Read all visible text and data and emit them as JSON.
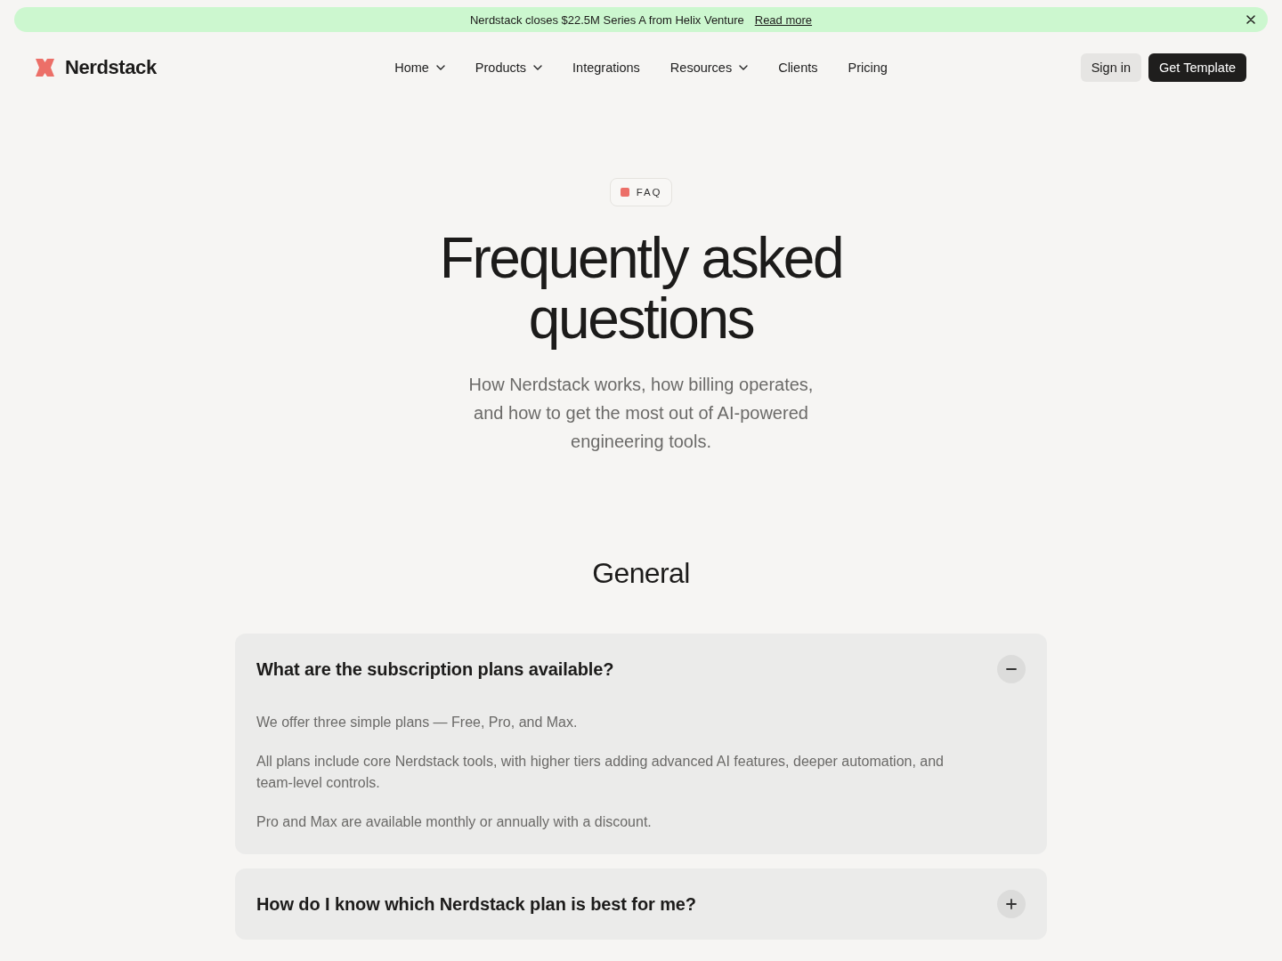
{
  "announcement": {
    "text": "Nerdstack closes $22.5M Series A from Helix Venture",
    "link": "Read more"
  },
  "nav": {
    "brand": "Nerdstack",
    "links": [
      {
        "label": "Home",
        "dropdown": true
      },
      {
        "label": "Products",
        "dropdown": true
      },
      {
        "label": "Integrations",
        "dropdown": false
      },
      {
        "label": "Resources",
        "dropdown": true
      },
      {
        "label": "Clients",
        "dropdown": false
      },
      {
        "label": "Pricing",
        "dropdown": false
      }
    ],
    "actions": [
      {
        "label": "Sign in",
        "kind": "secondary"
      },
      {
        "label": "Get Template",
        "kind": "primary"
      }
    ]
  },
  "hero": {
    "badge": "FAQ",
    "title": "Frequently asked questions",
    "subtitle": "How Nerdstack works, how billing operates, and how to get the most out of AI-powered engineering tools."
  },
  "faq": {
    "title": "General",
    "items": [
      {
        "question": "What are the subscription plans available?",
        "expanded": true,
        "answer": [
          "We offer three simple plans — Free, Pro, and Max.",
          "All plans include core Nerdstack tools, with higher tiers adding advanced AI features, deeper automation, and team-level controls.",
          "Pro and Max are available monthly or annually with a discount."
        ]
      },
      {
        "question": "How do I know which Nerdstack plan is best for me?",
        "expanded": false
      }
    ]
  }
}
